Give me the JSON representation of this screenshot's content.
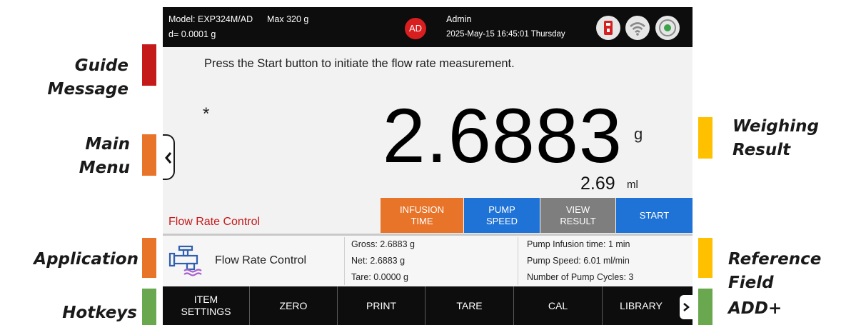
{
  "callouts": {
    "guide_message": "Guide Message",
    "main_menu_line1": "Main",
    "main_menu_line2": "Menu",
    "application": "Application",
    "hotkeys": "Hotkeys",
    "weighing_result_line1": "Weighing",
    "weighing_result_line2": "Result",
    "reference_field": "Reference Field",
    "add_plus": "ADD+"
  },
  "colors": {
    "guide_bar": "#c41a1a",
    "main_menu_bar": "#e8742a",
    "application_bar": "#e8742a",
    "hotkeys_bar": "#6aa84f",
    "weighing_bar": "#ffc000",
    "reference_bar": "#ffc000",
    "add_bar": "#6aa84f"
  },
  "status_bar": {
    "model": "Model: EXP324M/AD",
    "max": "Max 320 g",
    "resolution": "d= 0.0001 g",
    "avatar": "AD",
    "user": "Admin",
    "datetime": "2025-May-15 16:45:01 Thursday",
    "icons": [
      "usb-icon",
      "wifi-icon",
      "level-indicator-icon"
    ]
  },
  "guide_message": "Press the Start button to initiate the flow rate measurement.",
  "stability_mark": "*",
  "result": {
    "weight": "2.6883",
    "weight_unit": "g",
    "volume": "2.69",
    "volume_unit": "ml"
  },
  "application_title": "Flow Rate Control",
  "actions": {
    "infusion_line1": "INFUSION",
    "infusion_line2": "TIME",
    "pump_line1": "PUMP",
    "pump_line2": "SPEED",
    "view_line1": "VIEW",
    "view_line2": "RESULT",
    "start": "START"
  },
  "info": {
    "app_name": "Flow Rate Control",
    "gross": "Gross: 2.6883 g",
    "net": "Net: 2.6883 g",
    "tare": "Tare: 0.0000 g",
    "infusion_time": "Pump Infusion time: 1 min",
    "pump_speed": "Pump Speed: 6.01 ml/min",
    "pump_cycles": "Number of Pump Cycles: 3"
  },
  "hotkeys": {
    "item_settings_line1": "ITEM",
    "item_settings_line2": "SETTINGS",
    "zero": "ZERO",
    "print": "PRINT",
    "tare": "TARE",
    "cal": "CAL",
    "library": "LIBRARY"
  }
}
